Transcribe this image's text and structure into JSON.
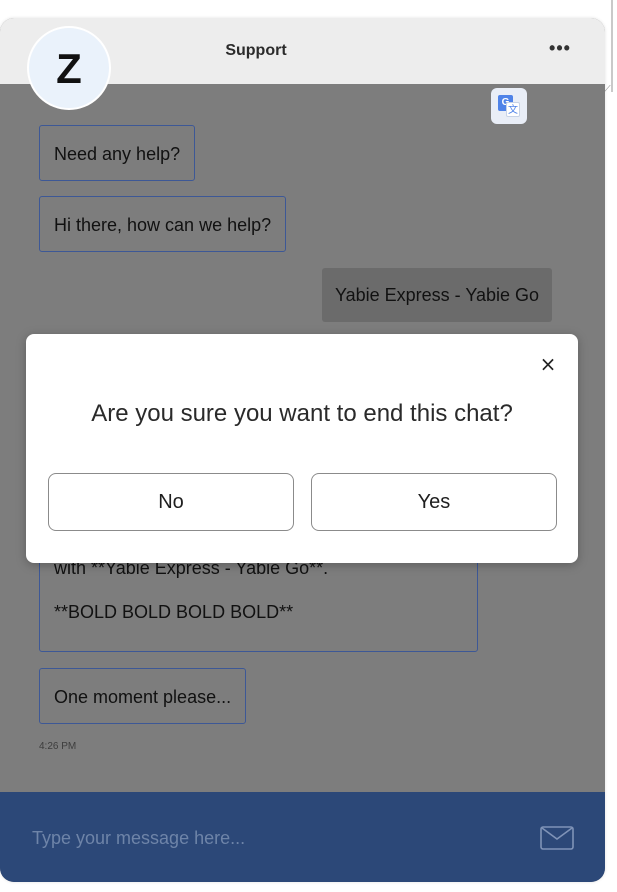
{
  "header": {
    "title": "Support",
    "more_label": "•••",
    "avatar_initial": "Z"
  },
  "messages": [
    {
      "from": "agent",
      "text": "Need any help?"
    },
    {
      "from": "agent",
      "text": "Hi there, how can we help?"
    },
    {
      "from": "user",
      "text": "Yabie Express - Yabie Go"
    },
    {
      "from": "agent",
      "lines": [
        "with **Yabie Express - Yabie Go**.",
        "**BOLD BOLD BOLD BOLD**"
      ]
    },
    {
      "from": "agent",
      "text": "One moment please..."
    }
  ],
  "timestamp": "4:26 PM",
  "composer": {
    "placeholder": "Type your message here...",
    "send_icon": "envelope-icon"
  },
  "dialog": {
    "title": "Are you sure you want to end this chat?",
    "no_label": "No",
    "yes_label": "Yes",
    "close_label": "×"
  },
  "colors": {
    "accent": "#2c4878",
    "bubble_border": "#3d5896",
    "overlay": "#7d7d7d"
  }
}
